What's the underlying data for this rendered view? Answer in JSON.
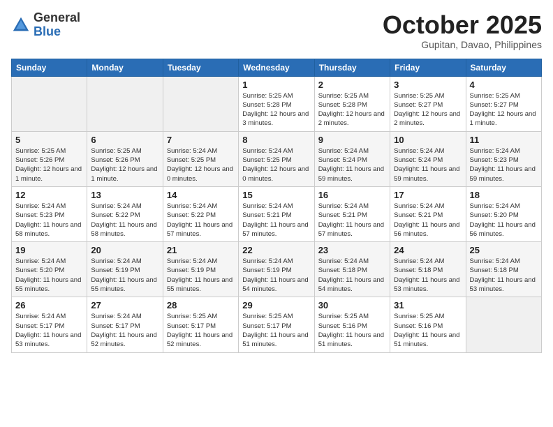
{
  "logo": {
    "general": "General",
    "blue": "Blue"
  },
  "header": {
    "month": "October 2025",
    "location": "Gupitan, Davao, Philippines"
  },
  "weekdays": [
    "Sunday",
    "Monday",
    "Tuesday",
    "Wednesday",
    "Thursday",
    "Friday",
    "Saturday"
  ],
  "weeks": [
    [
      {
        "day": "",
        "info": ""
      },
      {
        "day": "",
        "info": ""
      },
      {
        "day": "",
        "info": ""
      },
      {
        "day": "1",
        "info": "Sunrise: 5:25 AM\nSunset: 5:28 PM\nDaylight: 12 hours and 3 minutes."
      },
      {
        "day": "2",
        "info": "Sunrise: 5:25 AM\nSunset: 5:28 PM\nDaylight: 12 hours and 2 minutes."
      },
      {
        "day": "3",
        "info": "Sunrise: 5:25 AM\nSunset: 5:27 PM\nDaylight: 12 hours and 2 minutes."
      },
      {
        "day": "4",
        "info": "Sunrise: 5:25 AM\nSunset: 5:27 PM\nDaylight: 12 hours and 1 minute."
      }
    ],
    [
      {
        "day": "5",
        "info": "Sunrise: 5:25 AM\nSunset: 5:26 PM\nDaylight: 12 hours and 1 minute."
      },
      {
        "day": "6",
        "info": "Sunrise: 5:25 AM\nSunset: 5:26 PM\nDaylight: 12 hours and 1 minute."
      },
      {
        "day": "7",
        "info": "Sunrise: 5:24 AM\nSunset: 5:25 PM\nDaylight: 12 hours and 0 minutes."
      },
      {
        "day": "8",
        "info": "Sunrise: 5:24 AM\nSunset: 5:25 PM\nDaylight: 12 hours and 0 minutes."
      },
      {
        "day": "9",
        "info": "Sunrise: 5:24 AM\nSunset: 5:24 PM\nDaylight: 11 hours and 59 minutes."
      },
      {
        "day": "10",
        "info": "Sunrise: 5:24 AM\nSunset: 5:24 PM\nDaylight: 11 hours and 59 minutes."
      },
      {
        "day": "11",
        "info": "Sunrise: 5:24 AM\nSunset: 5:23 PM\nDaylight: 11 hours and 59 minutes."
      }
    ],
    [
      {
        "day": "12",
        "info": "Sunrise: 5:24 AM\nSunset: 5:23 PM\nDaylight: 11 hours and 58 minutes."
      },
      {
        "day": "13",
        "info": "Sunrise: 5:24 AM\nSunset: 5:22 PM\nDaylight: 11 hours and 58 minutes."
      },
      {
        "day": "14",
        "info": "Sunrise: 5:24 AM\nSunset: 5:22 PM\nDaylight: 11 hours and 57 minutes."
      },
      {
        "day": "15",
        "info": "Sunrise: 5:24 AM\nSunset: 5:21 PM\nDaylight: 11 hours and 57 minutes."
      },
      {
        "day": "16",
        "info": "Sunrise: 5:24 AM\nSunset: 5:21 PM\nDaylight: 11 hours and 57 minutes."
      },
      {
        "day": "17",
        "info": "Sunrise: 5:24 AM\nSunset: 5:21 PM\nDaylight: 11 hours and 56 minutes."
      },
      {
        "day": "18",
        "info": "Sunrise: 5:24 AM\nSunset: 5:20 PM\nDaylight: 11 hours and 56 minutes."
      }
    ],
    [
      {
        "day": "19",
        "info": "Sunrise: 5:24 AM\nSunset: 5:20 PM\nDaylight: 11 hours and 55 minutes."
      },
      {
        "day": "20",
        "info": "Sunrise: 5:24 AM\nSunset: 5:19 PM\nDaylight: 11 hours and 55 minutes."
      },
      {
        "day": "21",
        "info": "Sunrise: 5:24 AM\nSunset: 5:19 PM\nDaylight: 11 hours and 55 minutes."
      },
      {
        "day": "22",
        "info": "Sunrise: 5:24 AM\nSunset: 5:19 PM\nDaylight: 11 hours and 54 minutes."
      },
      {
        "day": "23",
        "info": "Sunrise: 5:24 AM\nSunset: 5:18 PM\nDaylight: 11 hours and 54 minutes."
      },
      {
        "day": "24",
        "info": "Sunrise: 5:24 AM\nSunset: 5:18 PM\nDaylight: 11 hours and 53 minutes."
      },
      {
        "day": "25",
        "info": "Sunrise: 5:24 AM\nSunset: 5:18 PM\nDaylight: 11 hours and 53 minutes."
      }
    ],
    [
      {
        "day": "26",
        "info": "Sunrise: 5:24 AM\nSunset: 5:17 PM\nDaylight: 11 hours and 53 minutes."
      },
      {
        "day": "27",
        "info": "Sunrise: 5:24 AM\nSunset: 5:17 PM\nDaylight: 11 hours and 52 minutes."
      },
      {
        "day": "28",
        "info": "Sunrise: 5:25 AM\nSunset: 5:17 PM\nDaylight: 11 hours and 52 minutes."
      },
      {
        "day": "29",
        "info": "Sunrise: 5:25 AM\nSunset: 5:17 PM\nDaylight: 11 hours and 51 minutes."
      },
      {
        "day": "30",
        "info": "Sunrise: 5:25 AM\nSunset: 5:16 PM\nDaylight: 11 hours and 51 minutes."
      },
      {
        "day": "31",
        "info": "Sunrise: 5:25 AM\nSunset: 5:16 PM\nDaylight: 11 hours and 51 minutes."
      },
      {
        "day": "",
        "info": ""
      }
    ]
  ]
}
